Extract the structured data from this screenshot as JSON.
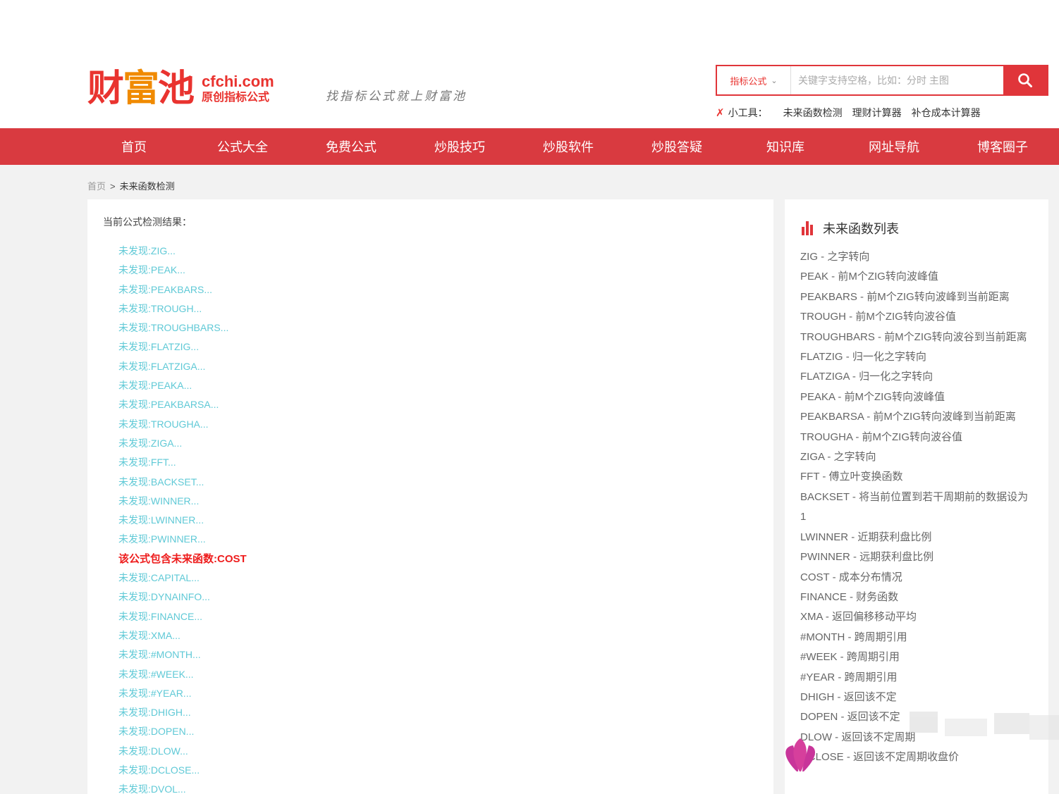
{
  "logo": {
    "text_a": "财",
    "text_b": "富",
    "text_c": "池",
    "domain": "cfchi.com",
    "subtitle": "原创指标公式"
  },
  "slogan": "找指标公式就上财富池",
  "search": {
    "category": "指标公式",
    "placeholder": "关键字支持空格，比如：分时 主图"
  },
  "tools": {
    "label": "小工具：",
    "links": [
      "未来函数检测",
      "理财计算器",
      "补仓成本计算器"
    ]
  },
  "nav": [
    "首页",
    "公式大全",
    "免费公式",
    "炒股技巧",
    "炒股软件",
    "炒股答疑",
    "知识库",
    "网址导航",
    "博客圈子"
  ],
  "breadcrumb": {
    "home": "首页",
    "separator": ">",
    "current": "未来函数检测"
  },
  "main": {
    "title": "当前公式检测结果：",
    "results": [
      "未发现:ZIG...",
      "未发现:PEAK...",
      "未发现:PEAKBARS...",
      "未发现:TROUGH...",
      "未发现:TROUGHBARS...",
      "未发现:FLATZIG...",
      "未发现:FLATZIGA...",
      "未发现:PEAKA...",
      "未发现:PEAKBARSA...",
      "未发现:TROUGHA...",
      "未发现:ZIGA...",
      "未发现:FFT...",
      "未发现:BACKSET...",
      "未发现:WINNER...",
      "未发现:LWINNER...",
      "未发现:PWINNER...",
      "该公式包含未来函数:COST",
      "未发现:CAPITAL...",
      "未发现:DYNAINFO...",
      "未发现:FINANCE...",
      "未发现:XMA...",
      "未发现:#MONTH...",
      "未发现:#WEEK...",
      "未发现:#YEAR...",
      "未发现:DHIGH...",
      "未发现:DOPEN...",
      "未发现:DLOW...",
      "未发现:DCLOSE...",
      "未发现:DVOL..."
    ],
    "hit_index": 16
  },
  "side": {
    "title": "未来函数列表",
    "items": [
      "ZIG - 之字转向",
      "PEAK - 前M个ZIG转向波峰值",
      "PEAKBARS - 前M个ZIG转向波峰到当前距离",
      "TROUGH - 前M个ZIG转向波谷值",
      "TROUGHBARS - 前M个ZIG转向波谷到当前距离",
      "FLATZIG - 归一化之字转向",
      "FLATZIGA - 归一化之字转向",
      "PEAKA - 前M个ZIG转向波峰值",
      "PEAKBARSA - 前M个ZIG转向波峰到当前距离",
      "TROUGHA - 前M个ZIG转向波谷值",
      "ZIGA - 之字转向",
      "FFT - 傅立叶变换函数",
      "BACKSET - 将当前位置到若干周期前的数据设为1",
      "LWINNER - 近期获利盘比例",
      "PWINNER - 远期获利盘比例",
      "COST - 成本分布情况",
      "FINANCE - 财务函数",
      "XMA - 返回偏移移动平均",
      "#MONTH - 跨周期引用",
      "#WEEK - 跨周期引用",
      "#YEAR - 跨周期引用",
      "DHIGH - 返回该不定",
      "DOPEN - 返回该不定",
      "DLOW - 返回该不定周期",
      "DCLOSE - 返回该不定周期收盘价"
    ]
  },
  "colors": {
    "brand_red": "#e0353a",
    "nav_red": "#d93a40",
    "link_cyan": "#5fc9d6",
    "hit_red": "#ee1c1c"
  }
}
